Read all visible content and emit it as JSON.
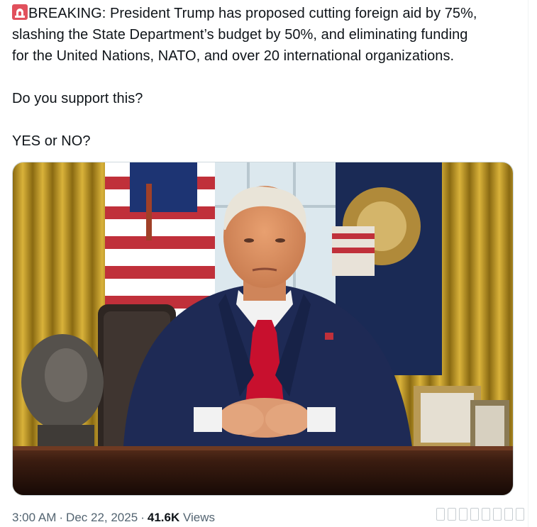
{
  "tweet": {
    "line1": "BREAKING: President Trump has proposed cutting foreign aid by 75%,",
    "line2": "slashing the State Department’s budget by 50%, and eliminating funding",
    "line3": "for the United Nations, NATO, and over 20 international organizations.",
    "question": "Do you support this?",
    "poll_prompt": "YES or NO?",
    "emoji_icon": "police-car-light-icon"
  },
  "meta": {
    "time": "3:00 AM",
    "separator": "·",
    "date": "Dec 22, 2025",
    "views_count": "41.6K",
    "views_label": "Views"
  },
  "colors": {
    "text": "#0f1419",
    "secondary": "#536471",
    "suit": "#1e2a55",
    "tie": "#c8102e",
    "curtain": "#c9a227"
  }
}
